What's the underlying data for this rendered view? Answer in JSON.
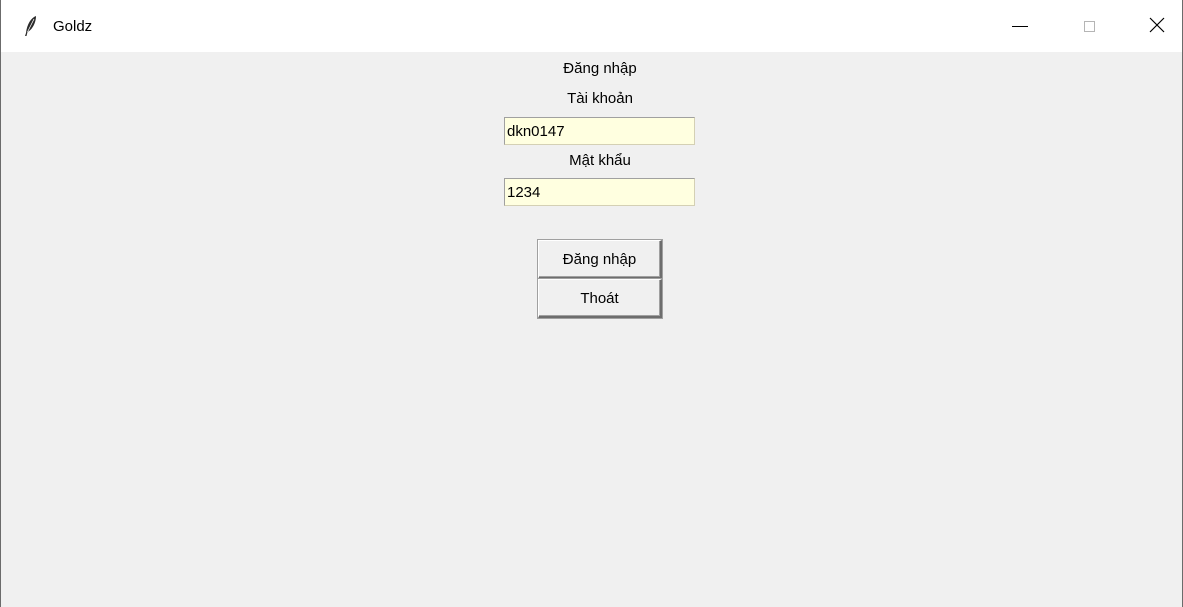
{
  "window": {
    "title": "Goldz",
    "icon": "feather-icon",
    "controls": [
      "minimize-icon",
      "maximize-icon",
      "close-icon"
    ]
  },
  "form": {
    "heading": "Đăng nhập",
    "username_label": "Tài khoản",
    "username_value": "dkn0147",
    "password_label": "Mật khẩu",
    "password_value": "1234",
    "login_button": "Đăng nhập",
    "exit_button": "Thoát"
  },
  "colors": {
    "entry_background": "#ffffe0",
    "window_background": "#f0f0f0",
    "titlebar_background": "#ffffff"
  }
}
